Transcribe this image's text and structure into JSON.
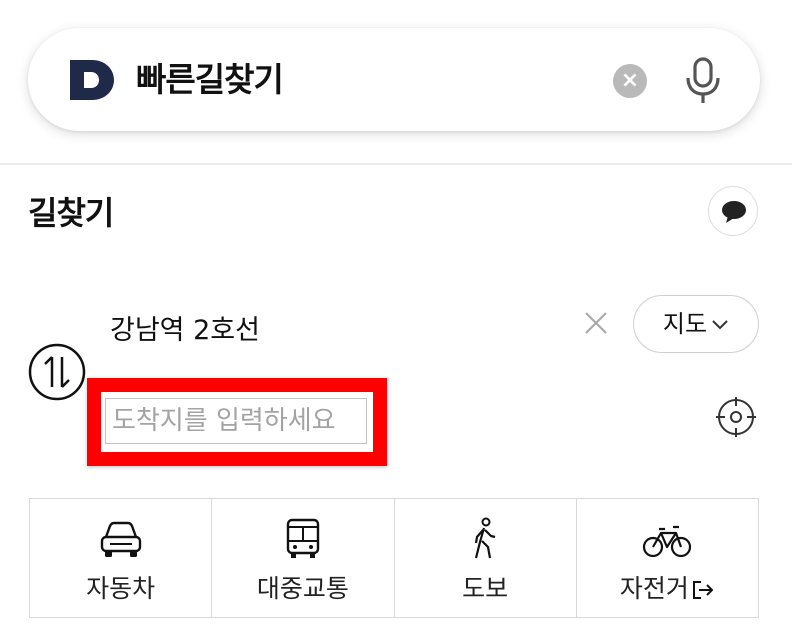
{
  "search": {
    "query": "빠른길찾기",
    "clear_label": "×"
  },
  "header": {
    "title": "길찾기"
  },
  "route": {
    "origin": "강남역 2호선",
    "destination_value": "",
    "destination_placeholder": "도착지를 입력하세요",
    "map_button": "지도"
  },
  "modes": [
    {
      "label": "자동차",
      "icon": "car-icon"
    },
    {
      "label": "대중교통",
      "icon": "bus-icon"
    },
    {
      "label": "도보",
      "icon": "walk-icon"
    },
    {
      "label": "자전거",
      "icon": "bicycle-icon"
    }
  ],
  "colors": {
    "logo": "#1e2a47",
    "highlight": "#ff0000",
    "clear_bg": "#b9b9b9"
  }
}
